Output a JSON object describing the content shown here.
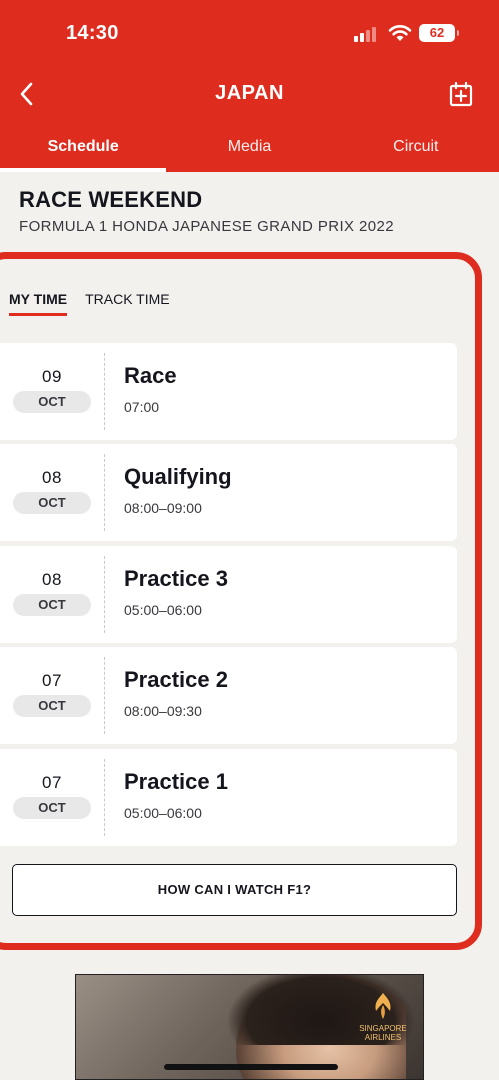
{
  "status_bar": {
    "time": "14:30",
    "battery": "62"
  },
  "nav": {
    "title": "JAPAN"
  },
  "tabs": [
    {
      "label": "Schedule"
    },
    {
      "label": "Media"
    },
    {
      "label": "Circuit"
    }
  ],
  "section": {
    "title": "RACE WEEKEND",
    "subtitle": "FORMULA 1 HONDA JAPANESE GRAND PRIX 2022"
  },
  "time_toggle": {
    "my_time": "MY TIME",
    "track_time": "TRACK TIME"
  },
  "sessions": [
    {
      "day": "09",
      "month": "OCT",
      "name": "Race",
      "time": "07:00"
    },
    {
      "day": "08",
      "month": "OCT",
      "name": "Qualifying",
      "time": "08:00–09:00"
    },
    {
      "day": "08",
      "month": "OCT",
      "name": "Practice 3",
      "time": "05:00–06:00"
    },
    {
      "day": "07",
      "month": "OCT",
      "name": "Practice 2",
      "time": "08:00–09:30"
    },
    {
      "day": "07",
      "month": "OCT",
      "name": "Practice 1",
      "time": "05:00–06:00"
    }
  ],
  "watch_button": {
    "label": "HOW CAN I WATCH F1?"
  },
  "ad": {
    "brand_line1": "SINGAPORE",
    "brand_line2": "AIRLINES"
  },
  "colors": {
    "brand_red": "#de2d1f",
    "background": "#f2f1ed",
    "text": "#15151e"
  }
}
